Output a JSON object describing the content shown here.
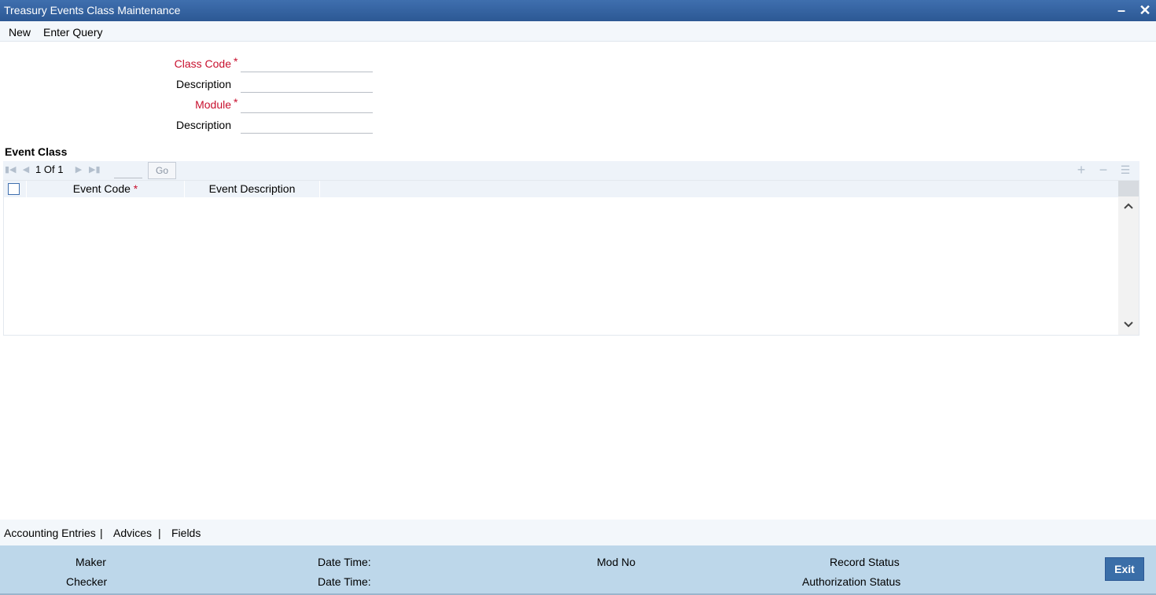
{
  "window": {
    "title": "Treasury Events Class Maintenance",
    "minimize_symbol": "–",
    "close_symbol": "✕"
  },
  "menu": {
    "new": "New",
    "enter_query": "Enter Query"
  },
  "form": {
    "class_code": {
      "label": "Class Code",
      "required_mark": "*",
      "value": ""
    },
    "class_description": {
      "label": "Description",
      "value": ""
    },
    "module": {
      "label": "Module",
      "required_mark": "*",
      "value": ""
    },
    "module_description": {
      "label": "Description",
      "value": ""
    }
  },
  "event_class": {
    "section_title": "Event Class",
    "pagination": {
      "current": "1",
      "of_label": "Of",
      "total": "1",
      "go_label": "Go"
    },
    "columns": [
      {
        "label": "Event Code",
        "required_mark": "*"
      },
      {
        "label": "Event Description"
      }
    ],
    "rows": []
  },
  "bottom_links": {
    "accounting_entries": "Accounting Entries",
    "advices": "Advices",
    "fields": "Fields",
    "separator": "|"
  },
  "audit": {
    "maker": "Maker",
    "checker": "Checker",
    "date_time": "Date Time:",
    "mod_no": "Mod No",
    "record_status": "Record Status",
    "authorization_status": "Authorization Status",
    "exit": "Exit"
  },
  "colors": {
    "titlebar": "#2c5894",
    "required": "#c8102e",
    "audit_bg": "#bdd7ea",
    "exit_button": "#3a6ea8"
  }
}
